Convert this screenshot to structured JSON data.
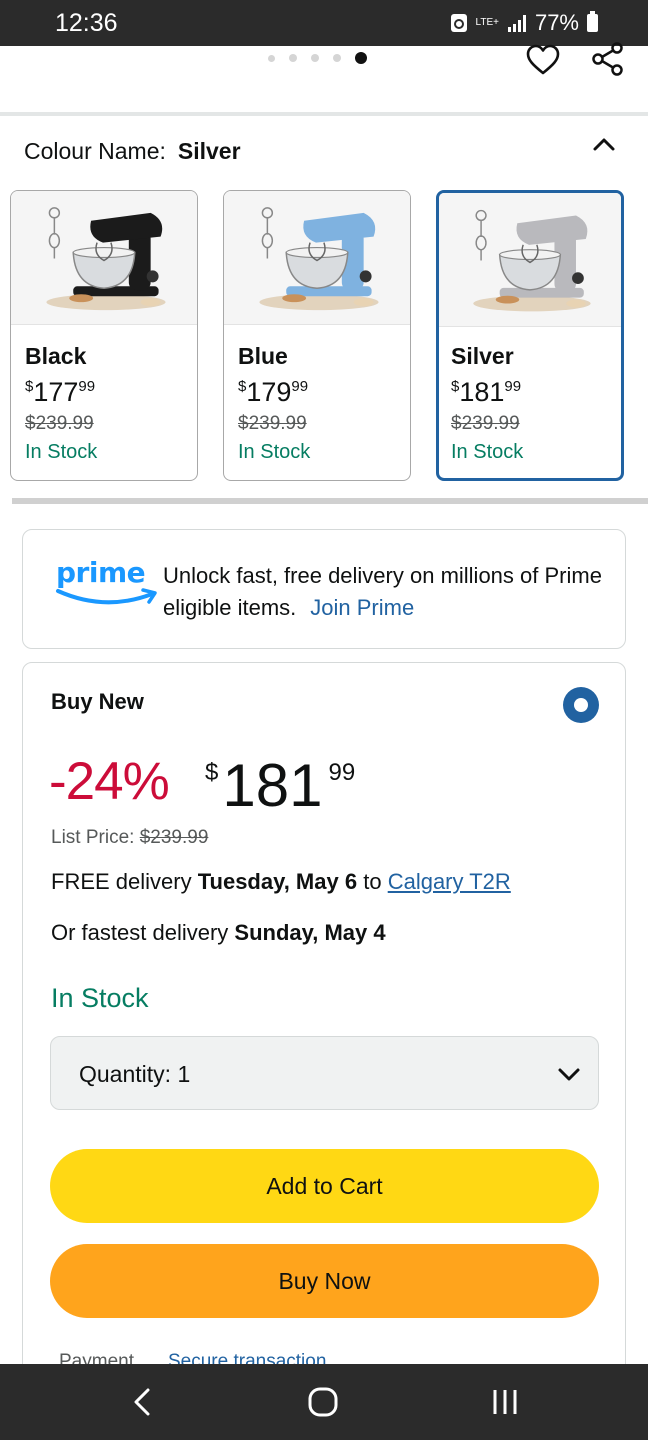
{
  "status_bar": {
    "time": "12:36",
    "network": "LTE+",
    "battery": "77%"
  },
  "carousel": {
    "dot_count": 5,
    "active_index": 4
  },
  "colour": {
    "label": "Colour Name:",
    "selected": "Silver",
    "variants": [
      {
        "name": "Black",
        "price_symbol": "$",
        "price_whole": "177",
        "price_cents": "99",
        "list_price": "$239.99",
        "stock": "In Stock",
        "color": "#1b1b1b",
        "selected": false
      },
      {
        "name": "Blue",
        "price_symbol": "$",
        "price_whole": "179",
        "price_cents": "99",
        "list_price": "$239.99",
        "stock": "In Stock",
        "color": "#7fb2e0",
        "selected": false
      },
      {
        "name": "Silver",
        "price_symbol": "$",
        "price_whole": "181",
        "price_cents": "99",
        "list_price": "$239.99",
        "stock": "In Stock",
        "color": "#b9b9bd",
        "selected": true
      }
    ]
  },
  "prime": {
    "logo": "prime",
    "text": "Unlock fast, free delivery on millions of Prime eligible items.",
    "join": "Join Prime"
  },
  "buy_box": {
    "title": "Buy New",
    "discount": "-24%",
    "price_symbol": "$",
    "price_whole": "181",
    "price_cents": "99",
    "list_price_label": "List Price:",
    "list_price": "$239.99",
    "delivery_prefix": "FREE delivery",
    "delivery_date": "Tuesday, May 6",
    "delivery_to": "to",
    "delivery_location": "Calgary T2R",
    "fastest_prefix": "Or fastest delivery",
    "fastest_date": "Sunday, May 4",
    "stock": "In Stock",
    "quantity_label": "Quantity:",
    "quantity_value": "1",
    "add_to_cart": "Add to Cart",
    "buy_now": "Buy Now",
    "payment_label": "Payment",
    "secure_label": "Secure transaction"
  },
  "colors": {
    "link": "#2162a1",
    "deal_red": "#cc0c39",
    "stock_green": "#067d62",
    "add_to_cart": "#ffd814",
    "buy_now": "#ffa41c",
    "prime_blue": "#1a98ff"
  },
  "icons": [
    "heart-icon",
    "share-icon",
    "chevron-up-icon",
    "chevron-down-icon",
    "radio-selected-icon",
    "back-nav-icon",
    "home-nav-icon",
    "recents-nav-icon"
  ]
}
